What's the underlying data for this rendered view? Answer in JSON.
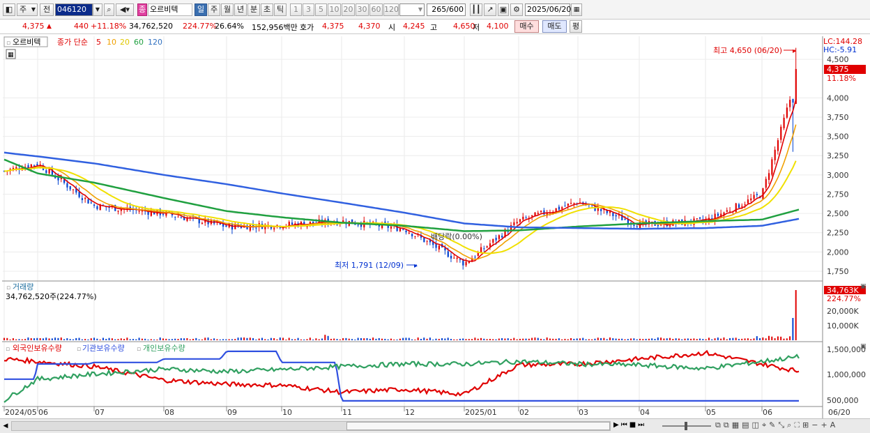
{
  "toolbar": {
    "period_sel": "주",
    "prev_btn": "전",
    "code": "046120",
    "stock_badge": "종",
    "stock_name": "오르비텍",
    "periods": [
      "일",
      "주",
      "월",
      "년",
      "분",
      "초",
      "틱"
    ],
    "active_period": "일",
    "intervals": [
      "1",
      "3",
      "5",
      "10",
      "20",
      "30",
      "60",
      "120"
    ],
    "count": "265",
    "count_total": "/600",
    "date": "2025/06/20"
  },
  "quote": {
    "price": "4,375",
    "change": "440",
    "change_pct": "+11.18%",
    "volume": "34,762,520",
    "volume_ratio": "224.77%",
    "turnover_rate": "26.64%",
    "amount": "152,956백만",
    "ask_label": "호가",
    "ask1": "4,375",
    "ask2": "4,370",
    "open_label": "시",
    "open": "4,245",
    "high_label": "고",
    "high": "4,650",
    "low_label": "저",
    "low": "4,100",
    "buy_btn": "매수",
    "sell_btn": "매도",
    "eval_btn": "평"
  },
  "price_panel": {
    "legend_name": "오르비텍",
    "legend_ma_label": "종가 단순",
    "ma_periods": [
      "5",
      "10",
      "20",
      "60",
      "120"
    ],
    "lc": "LC:144.28",
    "hc": "HC:-5.91",
    "high_note": "최고 4,650 (06/20)",
    "low_note": "최저 1,791 (12/09)",
    "dividend_note": "배당락(0.00%)",
    "current_price_tag": "4,375",
    "current_pct_tag": "11.18%",
    "y_ticks": [
      "4,500",
      "4,000",
      "3,750",
      "3,500",
      "3,250",
      "3,000",
      "2,750",
      "2,500",
      "2,250",
      "2,000",
      "1,750"
    ]
  },
  "volume_panel": {
    "title": "거래량",
    "value": "34,762,520주(224.77%)",
    "tag": "34,763K",
    "tag_pct": "224.77%",
    "y_ticks": [
      "20,000K",
      "10,000K"
    ]
  },
  "holding_panel": {
    "legend": [
      "외국인보유수량",
      "기관보유수량",
      "개인보유수량"
    ],
    "y_ticks": [
      "1,500,000",
      "1,000,000",
      "500,000"
    ]
  },
  "x_axis": {
    "labels": [
      "2024/05",
      "06",
      "07",
      "08",
      "09",
      "10",
      "11",
      "12",
      "2025/01",
      "02",
      "03",
      "04",
      "05",
      "06"
    ],
    "right_label": "06/20"
  },
  "colors": {
    "up": "#e00000",
    "down": "#0040d0",
    "ma5": "#e00000",
    "ma10": "#f0a000",
    "ma20": "#f0e000",
    "ma60": "#20a040",
    "ma120": "#3060e0",
    "foreign": "#e00000",
    "institution": "#3050e0",
    "individual": "#30a060"
  },
  "chart_data": [
    {
      "type": "line",
      "title": "오르비텍",
      "ylim": [
        1650,
        4800
      ],
      "x": [
        "2024/05",
        "06",
        "07",
        "08",
        "09",
        "10",
        "11",
        "12",
        "2025/01",
        "02",
        "03",
        "04",
        "05",
        "06",
        "06/20"
      ],
      "series": [
        {
          "name": "종가",
          "values": [
            3050,
            3150,
            2600,
            2500,
            2330,
            2350,
            2400,
            2300,
            1850,
            2400,
            2650,
            2350,
            2400,
            2750,
            4375
          ]
        },
        {
          "name": "60",
          "values": [
            3200,
            3020,
            2900,
            2700,
            2530,
            2450,
            2380,
            2340,
            2270,
            2280,
            2330,
            2370,
            2400,
            2420,
            2550
          ]
        },
        {
          "name": "120",
          "values": [
            3290,
            3240,
            3150,
            3000,
            2880,
            2760,
            2640,
            2510,
            2370,
            2320,
            2310,
            2300,
            2310,
            2340,
            2430
          ]
        }
      ],
      "high": {
        "value": 4650,
        "date": "06/20"
      },
      "low": {
        "value": 1791,
        "date": "12/09"
      }
    },
    {
      "type": "bar",
      "title": "거래량",
      "ylim": [
        0,
        34763000
      ],
      "last_value": 34762520,
      "last_ratio_pct": 224.77
    },
    {
      "type": "line",
      "ylim": [
        400000,
        1600000
      ],
      "x": [
        "2024/05",
        "06",
        "07",
        "08",
        "09",
        "10",
        "11",
        "12",
        "2025/01",
        "02",
        "03",
        "04",
        "05",
        "06"
      ],
      "series": [
        {
          "name": "외국인보유수량",
          "values": [
            1300000,
            1250000,
            1150000,
            880000,
            800000,
            780000,
            640000,
            700000,
            600000,
            1180000,
            1200000,
            1300000,
            1420000,
            1200000
          ]
        },
        {
          "name": "기관보유수량",
          "values": [
            900000,
            1200000,
            1230000,
            1300000,
            1450000,
            1230000,
            470000,
            470000,
            470000,
            470000,
            470000,
            470000,
            470000,
            470000
          ]
        },
        {
          "name": "개인보유수량",
          "values": [
            480000,
            900000,
            1000000,
            1100000,
            1050000,
            1090000,
            1150000,
            1200000,
            1200000,
            1250000,
            1200000,
            1180000,
            1110000,
            1250000
          ]
        }
      ]
    }
  ]
}
